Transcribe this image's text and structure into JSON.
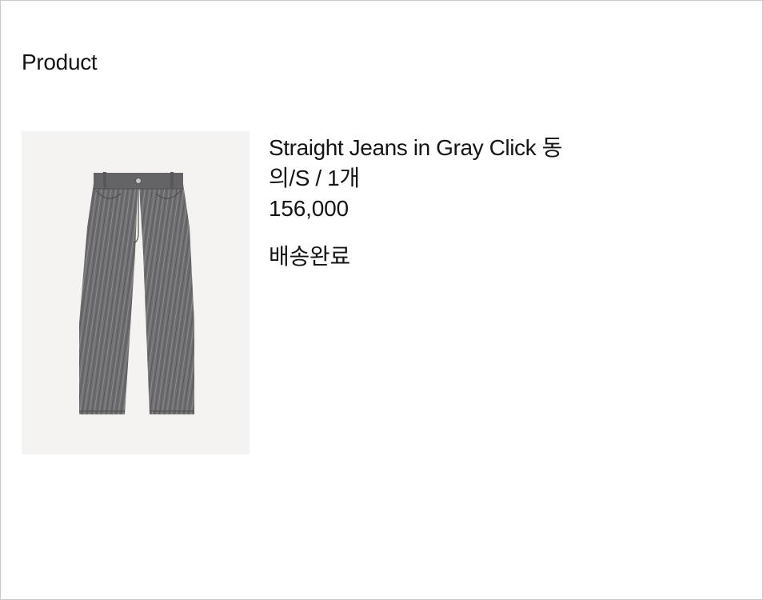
{
  "section": {
    "title": "Product"
  },
  "product": {
    "image_alt": "gray straight jeans",
    "name_line1": "Straight Jeans in Gray Click   동",
    "name_line2": "의/S / 1개",
    "price": "156,000",
    "status": "배송완료"
  }
}
